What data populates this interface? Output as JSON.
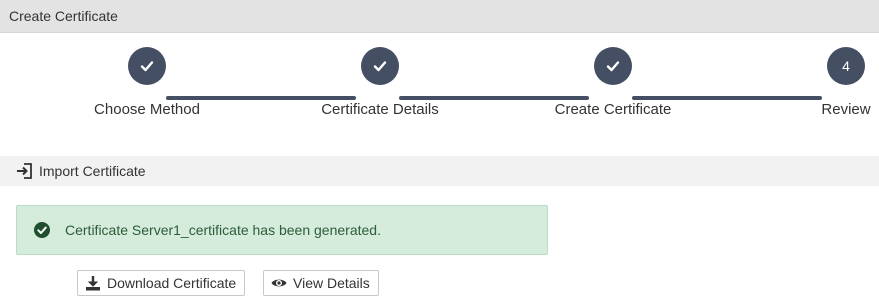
{
  "title_bar": {
    "title": "Create Certificate"
  },
  "wizard": {
    "steps": [
      {
        "label": "Choose Method",
        "status": "complete",
        "icon": "check-icon"
      },
      {
        "label": "Certificate Details",
        "status": "complete",
        "icon": "check-icon"
      },
      {
        "label": "Create Certificate",
        "status": "complete",
        "icon": "check-icon"
      },
      {
        "label": "Review",
        "status": "current",
        "number": "4"
      }
    ],
    "accent_color": "#454f64"
  },
  "section": {
    "label": "Import Certificate",
    "icon": "import-icon"
  },
  "alert": {
    "message": "Certificate Server1_certificate has been generated.",
    "icon": "check-circle-icon",
    "background": "#d5ebdc",
    "text_color": "#2b5d3a"
  },
  "actions": {
    "download_label": "Download Certificate",
    "download_icon": "download-icon",
    "view_label": "View Details",
    "view_icon": "eye-icon"
  }
}
